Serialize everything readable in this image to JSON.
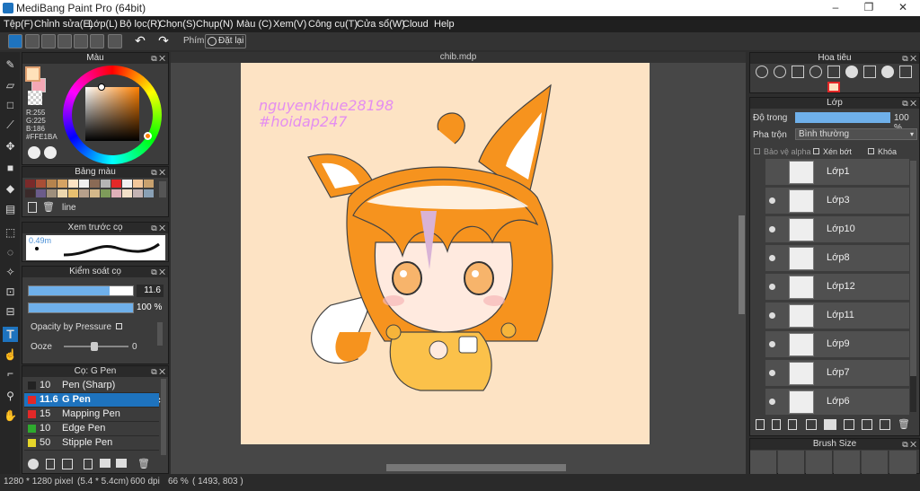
{
  "app": {
    "title": "MediBang Paint Pro (64bit)"
  },
  "menu": [
    "Tệp(F)",
    "Chỉnh sửa(E)",
    "Lớp(L)",
    "Bộ lọc(R)",
    "Chọn(S)",
    "Chụp(N)",
    "Màu (C)",
    "Xem(V)",
    "Công cụ(T)",
    "Cửa sổ(W)",
    "Cloud",
    "Help"
  ],
  "toolbar": {
    "phim_label": "Phím",
    "reset_label": "Đặt lại"
  },
  "color_panel": {
    "title": "Màu",
    "r": "R:255",
    "g": "G:225",
    "b": "B:186",
    "hex": "#FFE1BA",
    "primary": "#FFE1BA",
    "secondary": "#f4a7b5"
  },
  "palette_panel": {
    "title": "Bảng màu",
    "item_label": "line",
    "colors": [
      "#7a2a2a",
      "#a84e35",
      "#b5834d",
      "#d6a363",
      "#fde3c4",
      "#efefef",
      "#8a6a55",
      "#b5b5b5",
      "#e32828",
      "#f0f0f0",
      "#f2c79b",
      "#c9a16e",
      "#3a2a2a",
      "#6b5b8a",
      "#9e8f7c",
      "#ecd7ae",
      "#e8c070",
      "#b7a08b",
      "#d3b88a",
      "#7e9b5a",
      "#e0b0b8",
      "#f3e0c8",
      "#c4b3b3",
      "#89a0b5"
    ]
  },
  "brush_preview": {
    "title": "Xem trước cọ",
    "size_label": "0.49m"
  },
  "brush_control": {
    "title": "Kiểm soát cọ",
    "size": "11.6",
    "size_fraction": 0.78,
    "opacity": "100 %",
    "opacity_fraction": 1.0,
    "pressure_label": "Opacity by Pressure",
    "ooze_label": "Ooze",
    "ooze_value": "0"
  },
  "brush_list": {
    "title": "Cọ: G Pen",
    "items": [
      {
        "size": "10",
        "name": "Pen (Sharp)",
        "color": "#222222",
        "selected": false
      },
      {
        "size": "11.6",
        "name": "G Pen",
        "color": "#e32828",
        "selected": true
      },
      {
        "size": "15",
        "name": "Mapping Pen",
        "color": "#e32828",
        "selected": false
      },
      {
        "size": "10",
        "name": "Edge Pen",
        "color": "#2eaa2e",
        "selected": false
      },
      {
        "size": "50",
        "name": "Stipple Pen",
        "color": "#e6d62a",
        "selected": false
      }
    ]
  },
  "document": {
    "tab": "chib.mdp",
    "watermark1": "nguyenkhue28198",
    "watermark2": "#hoidap247"
  },
  "navigator": {
    "title": "Hoa tiêu"
  },
  "layer_panel": {
    "title": "Lớp",
    "opacity_label": "Độ trong",
    "opacity_value": "100 %",
    "blend_label": "Pha trộn",
    "blend_value": "Bình thường",
    "protect_label": "Bảo vệ alpha",
    "clip_label": "Xén bớt",
    "lock_label": "Khóa",
    "layers": [
      "Lớp1",
      "Lớp3",
      "Lớp10",
      "Lớp8",
      "Lớp12",
      "Lớp11",
      "Lớp9",
      "Lớp7",
      "Lớp6"
    ]
  },
  "brush_size_panel": {
    "title": "Brush Size"
  },
  "status": {
    "dims": "1280 * 1280 pixel",
    "size": "(5.4 * 5.4cm)",
    "dpi": "600 dpi",
    "zoom": "66 %",
    "coords": "( 1493, 803 )"
  }
}
